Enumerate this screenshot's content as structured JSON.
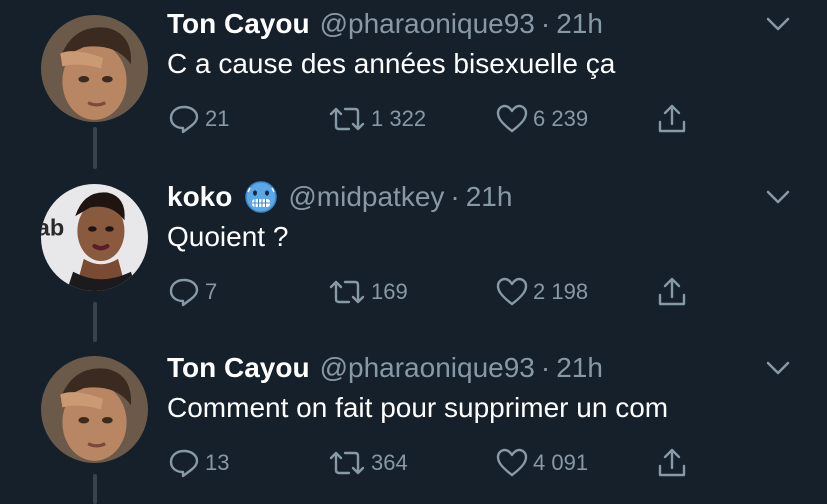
{
  "tweets": [
    {
      "name": "Ton Cayou",
      "handle": "@pharaonique93",
      "dot": "·",
      "time": "21h",
      "text": "C a cause des années bisexuelle ça",
      "replies": "21",
      "retweets": "1 322",
      "likes": "6 239",
      "avatar": "avatar-boy"
    },
    {
      "name": "koko",
      "emoji": "cold-face-emoji",
      "handle": "@midpatkey",
      "dot": "·",
      "time": "21h",
      "text": "Quoient ?",
      "replies": "7",
      "retweets": "169",
      "likes": "2 198",
      "avatar": "avatar-woman"
    },
    {
      "name": "Ton Cayou",
      "handle": "@pharaonique93",
      "dot": "·",
      "time": "21h",
      "text": "Comment on fait pour supprimer un com",
      "replies": "13",
      "retweets": "364",
      "likes": "4 091",
      "avatar": "avatar-boy"
    }
  ],
  "colors": {
    "background": "#15202b",
    "secondary_text": "#8899a6",
    "thread_line": "#38444d"
  }
}
